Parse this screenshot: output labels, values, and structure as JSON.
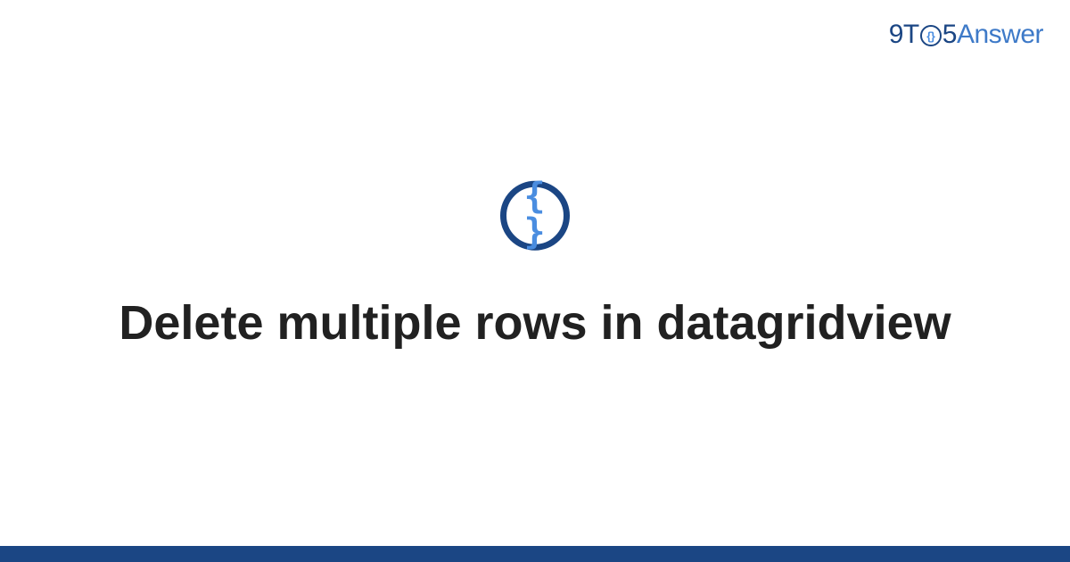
{
  "logo": {
    "part1": "9T",
    "o_inner": "{}",
    "part2": "5",
    "part3": "Answer"
  },
  "icon": {
    "name": "code-braces-icon",
    "glyph": "{ }"
  },
  "title": "Delete multiple rows in datagridview",
  "colors": {
    "primary_dark": "#1b4684",
    "primary_light": "#4a8de0",
    "text": "#212121"
  }
}
